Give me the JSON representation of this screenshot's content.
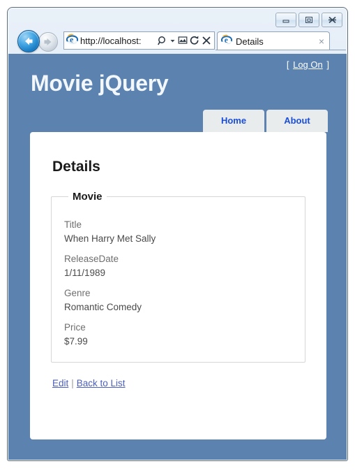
{
  "browser": {
    "window_controls": [
      {
        "name": "minimize",
        "label": "Minimize"
      },
      {
        "name": "restore",
        "label": "Restore"
      },
      {
        "name": "close",
        "label": "Close"
      }
    ],
    "back_label": "Back",
    "forward_label": "Forward",
    "address": {
      "url": "http://localhost:",
      "placeholder": "http://localhost:",
      "icons": [
        "search-icon",
        "dropdown-arrow-icon",
        "compatibility-view-icon",
        "refresh-icon",
        "stop-icon"
      ]
    },
    "tab": {
      "title": "Details",
      "close_label": "×"
    }
  },
  "page": {
    "site_title": "Movie jQuery",
    "logon": {
      "open_bracket": "[",
      "link": "Log On",
      "close_bracket": "]"
    },
    "nav": [
      {
        "label": "Home"
      },
      {
        "label": "About"
      }
    ],
    "heading": "Details",
    "fieldset": {
      "legend": "Movie",
      "fields": [
        {
          "label": "Title",
          "value": "When Harry Met Sally"
        },
        {
          "label": "ReleaseDate",
          "value": "1/11/1989"
        },
        {
          "label": "Genre",
          "value": "Romantic Comedy"
        },
        {
          "label": "Price",
          "value": "$7.99"
        }
      ]
    },
    "actions": {
      "edit": "Edit",
      "separator": "|",
      "back_to_list": "Back to List"
    }
  },
  "colors": {
    "page_background": "#5c82b0",
    "card_background": "#ffffff",
    "nav_tab_text": "#1a4ed8",
    "link": "#4a5fc1",
    "heading": "#1a1a1a",
    "field_label": "#6e6e6e",
    "field_value": "#4a4a4a"
  }
}
